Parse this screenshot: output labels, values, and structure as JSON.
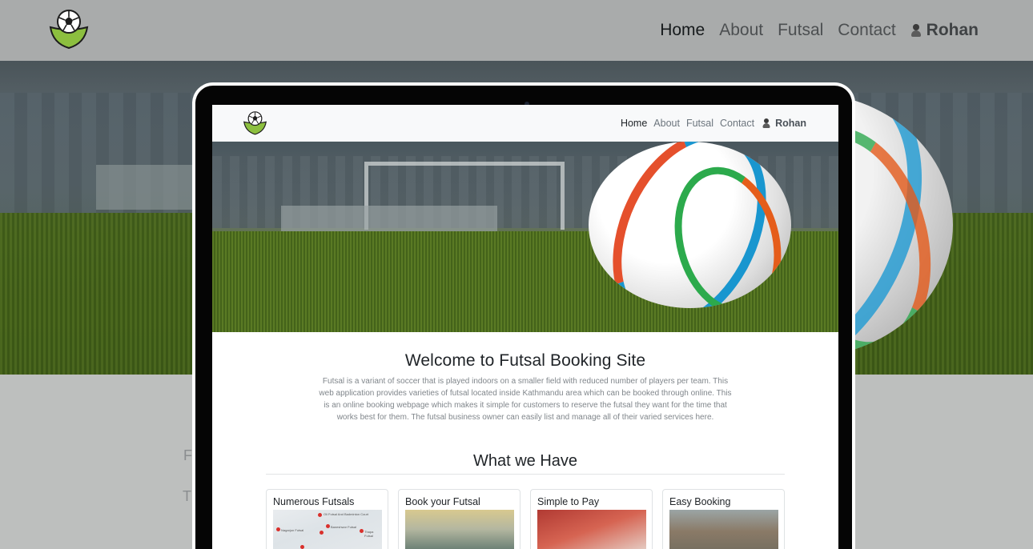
{
  "nav": {
    "links": [
      "Home",
      "About",
      "Futsal",
      "Contact"
    ],
    "active": "Home",
    "user": "Rohan"
  },
  "background_text": [
    "Fu",
    "Th"
  ],
  "welcome": {
    "title": "Welcome to Futsal Booking Site",
    "paragraph": "Futsal is a variant of soccer that is played indoors on a smaller field with reduced number of players per team. This web application provides varieties of futsal located inside Kathmandu area which can be booked through online. This is an online booking webpage which makes it simple for customers to reserve the futsal they want for the time that works best for them. The futsal business owner can easily list and manage all of their varied services here."
  },
  "features": {
    "title": "What we Have",
    "cards": [
      {
        "title": "Numerous Futsals",
        "image": "map-image"
      },
      {
        "title": "Book your Futsal",
        "image": "futsal-court-image"
      },
      {
        "title": "Simple to Pay",
        "image": "payment-image"
      },
      {
        "title": "Easy Booking",
        "image": "booking-image"
      }
    ]
  },
  "map_labels": [
    "Oli Futsal And Badminton Court",
    "Nagarjun Futsal",
    "Baneshwor Futsal",
    "Thapa Futsal"
  ],
  "icons": {
    "logo": "soccer-ball-logo-icon",
    "user": "user-avatar-icon"
  },
  "colors": {
    "nav_bg": "#f8f9fa",
    "text_dark": "#212529",
    "text_muted": "#6c757d",
    "logo_green": "#8cbf3f"
  }
}
